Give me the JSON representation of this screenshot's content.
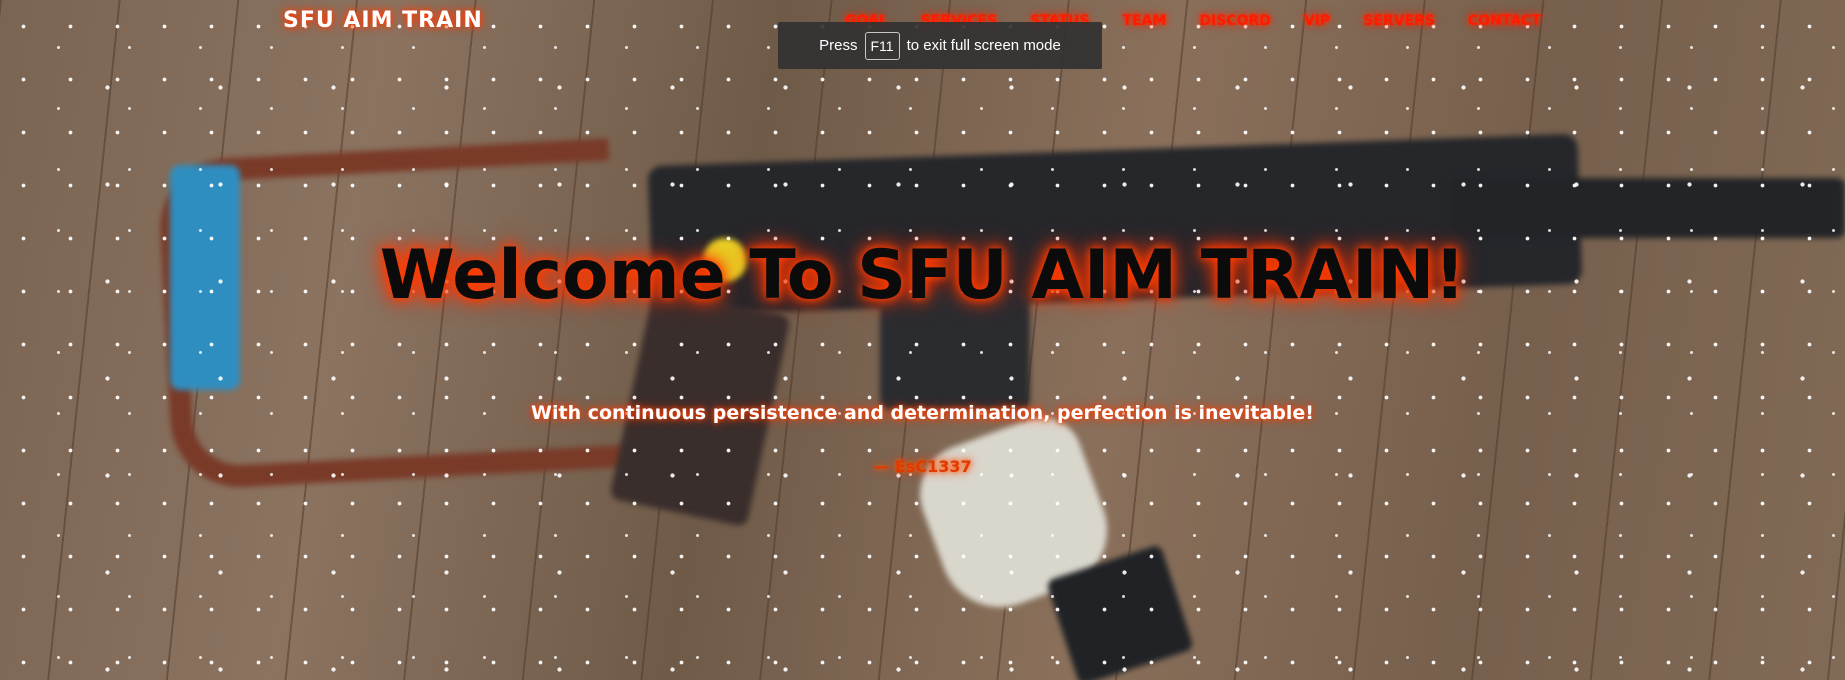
{
  "nav": {
    "brand": "SFU AIM TRAIN",
    "links": [
      "GOAL",
      "SERVICES",
      "STATUS",
      "TEAM",
      "DISCORD",
      "VIP",
      "SERVERS",
      "CONTACT"
    ]
  },
  "fullscreen_toast": {
    "prefix": "Press",
    "key": "F11",
    "suffix": "to exit full screen mode"
  },
  "hero": {
    "title": "Welcome To SFU AIM TRAIN!",
    "subtitle": "With continuous persistence and determination, perfection is inevitable!",
    "author": "— EsC1337"
  },
  "colors": {
    "accent_glow": "#ff3d00",
    "nav_link": "#ff1a00",
    "title_text": "#0b0b0b",
    "toast_bg": "#323232"
  }
}
